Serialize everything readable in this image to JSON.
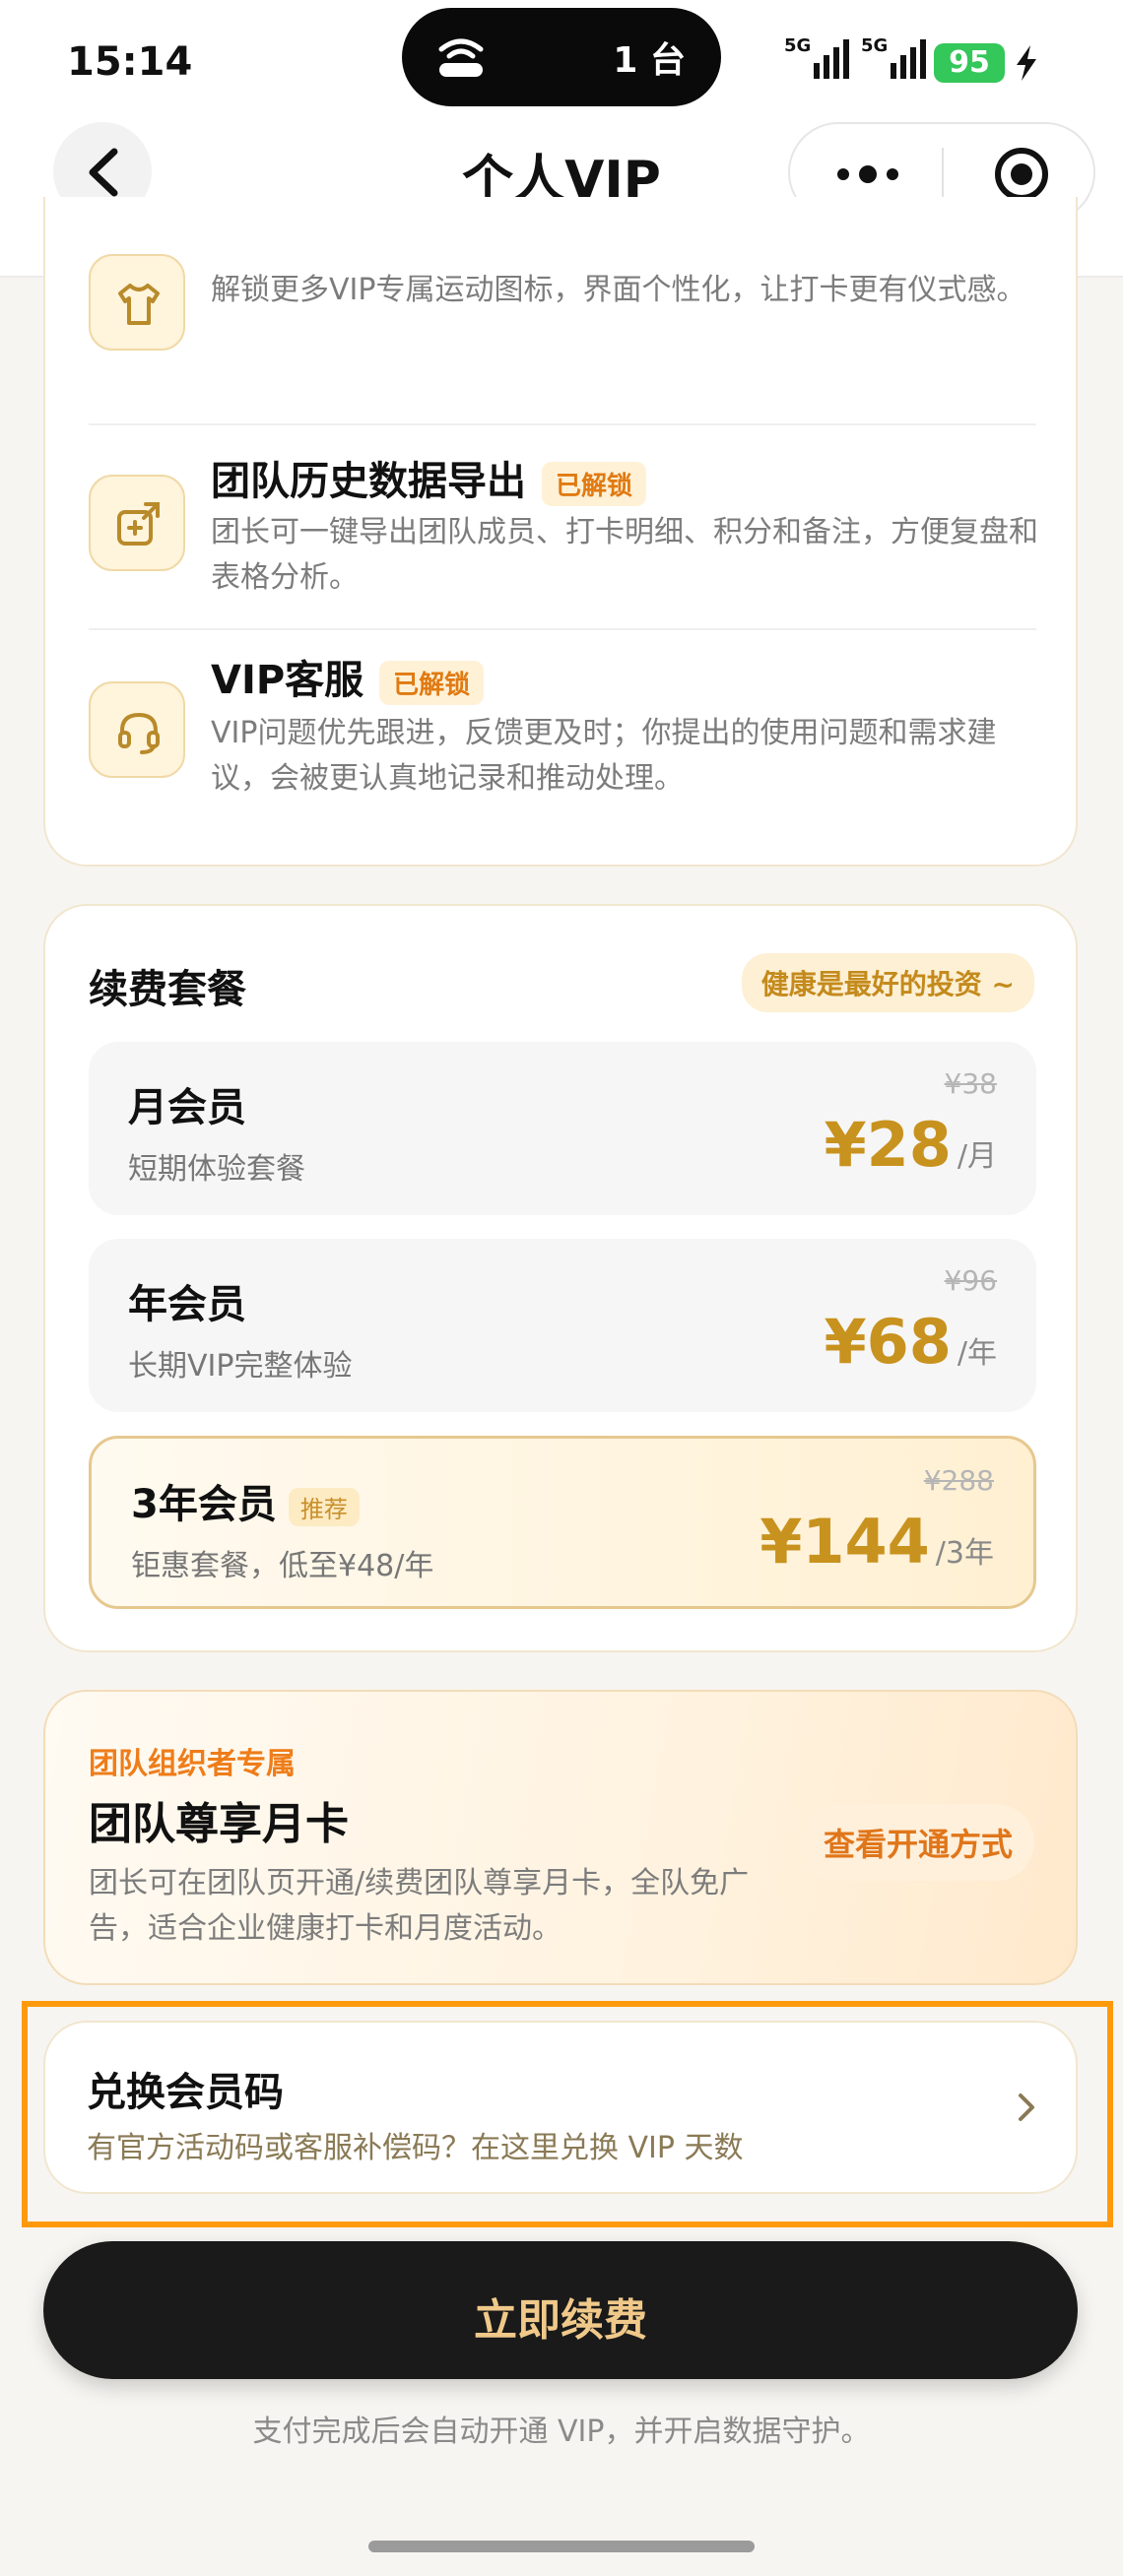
{
  "status_bar": {
    "time": "15:14",
    "island_text": "1 台",
    "network_1": "5G",
    "network_2": "5G",
    "battery": "95"
  },
  "nav": {
    "title": "个人VIP"
  },
  "features": [
    {
      "icon": "tshirt-icon",
      "title": "",
      "badge": "",
      "desc": "解锁更多VIP专属运动图标，界面个性化，让打卡更有仪式感。"
    },
    {
      "icon": "export-icon",
      "title": "团队历史数据导出",
      "badge": "已解锁",
      "desc": "团长可一键导出团队成员、打卡明细、积分和备注，方便复盘和表格分析。"
    },
    {
      "icon": "headset-icon",
      "title": "VIP客服",
      "badge": "已解锁",
      "desc": "VIP问题优先跟进，反馈更及时；你提出的使用问题和需求建议，会被更认真地记录和推动处理。"
    }
  ],
  "plans": {
    "title": "续费套餐",
    "slogan": "健康是最好的投资 ~",
    "items": [
      {
        "name": "月会员",
        "tag": "",
        "sub": "短期体验套餐",
        "old_price": "¥38",
        "price": "¥28",
        "unit": "/月"
      },
      {
        "name": "年会员",
        "tag": "",
        "sub": "长期VIP完整体验",
        "old_price": "¥96",
        "price": "¥68",
        "unit": "/年"
      },
      {
        "name": "3年会员",
        "tag": "推荐",
        "sub": "钜惠套餐，低至¥48/年",
        "old_price": "¥288",
        "price": "¥144",
        "unit": "/3年"
      }
    ]
  },
  "team": {
    "kicker": "团队组织者专属",
    "title": "团队尊享月卡",
    "desc": "团长可在团队页开通/续费团队尊享月卡，全队免广告，适合企业健康打卡和月度活动。",
    "button": "查看开通方式"
  },
  "redeem": {
    "title": "兑换会员码",
    "desc": "有官方活动码或客服补偿码？在这里兑换 VIP 天数"
  },
  "cta": {
    "label": "立即续费",
    "footnote": "支付完成后会自动开通 VIP，并开启数据守护。"
  },
  "colors": {
    "accent_gold": "#c8921e",
    "accent_orange": "#ee7d1a",
    "highlight_frame": "#ff9a0f",
    "cta_bg": "#1a1a1a"
  }
}
